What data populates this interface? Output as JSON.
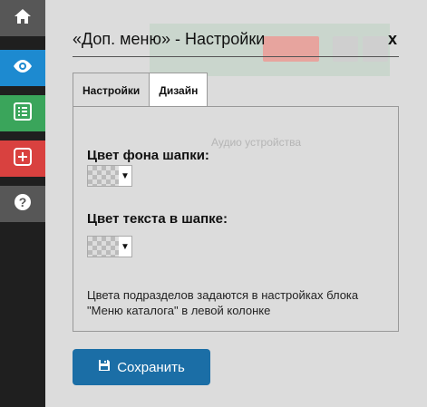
{
  "sidebar": {
    "items": [
      {
        "icon": "home-icon"
      },
      {
        "icon": "eye-icon"
      },
      {
        "icon": "list-icon"
      },
      {
        "icon": "plus-icon"
      },
      {
        "icon": "question-icon"
      }
    ]
  },
  "background": {
    "faded_text": "Аудио устройства"
  },
  "modal": {
    "title": "«Доп. меню» - Настройки",
    "close_label": "x",
    "tabs": [
      {
        "label": "Настройки",
        "active": false
      },
      {
        "label": "Дизайн",
        "active": true
      }
    ],
    "fields": [
      {
        "label": "Цвет фона шапки:",
        "arrow": "▼"
      },
      {
        "label": "Цвет текста в шапке:",
        "arrow": "▼"
      }
    ],
    "note": "Цвета подразделов задаются в настройках блока \"Меню каталога\" в левой колонке",
    "save_label": "Сохранить"
  },
  "colors": {
    "sidebar_bg": "#1f1f1f",
    "home": "#575757",
    "eye": "#1d8ad0",
    "list": "#3aa55b",
    "add": "#d9413f",
    "help": "#575757",
    "save_button": "#1b6ea6"
  }
}
